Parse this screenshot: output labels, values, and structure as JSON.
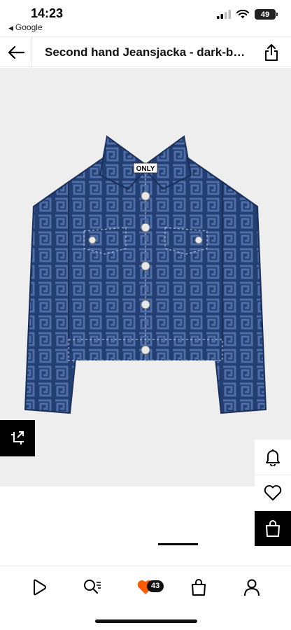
{
  "status_bar": {
    "time": "14:23",
    "back_app": "Google",
    "battery": "49"
  },
  "header": {
    "title": "Second hand Jeansjacka - dark-blue denim",
    "back_icon": "arrow-left-icon",
    "share_icon": "share-icon"
  },
  "product": {
    "label_brand": "ONLY",
    "image_colors": {
      "background": "#eeeeef",
      "denim": "#233e72",
      "pattern": "#4f6ea8"
    }
  },
  "actions": {
    "gallery_icon": "expand-image-icon",
    "bell_icon": "bell-icon",
    "wishlist_icon": "heart-icon",
    "bag_icon": "shopping-bag-icon"
  },
  "bottom_nav": {
    "items": [
      "home-icon",
      "search-icon",
      "wishlist-icon",
      "bag-icon",
      "account-icon"
    ],
    "wishlist_count": "43",
    "wishlist_color": "#ff5a00"
  }
}
